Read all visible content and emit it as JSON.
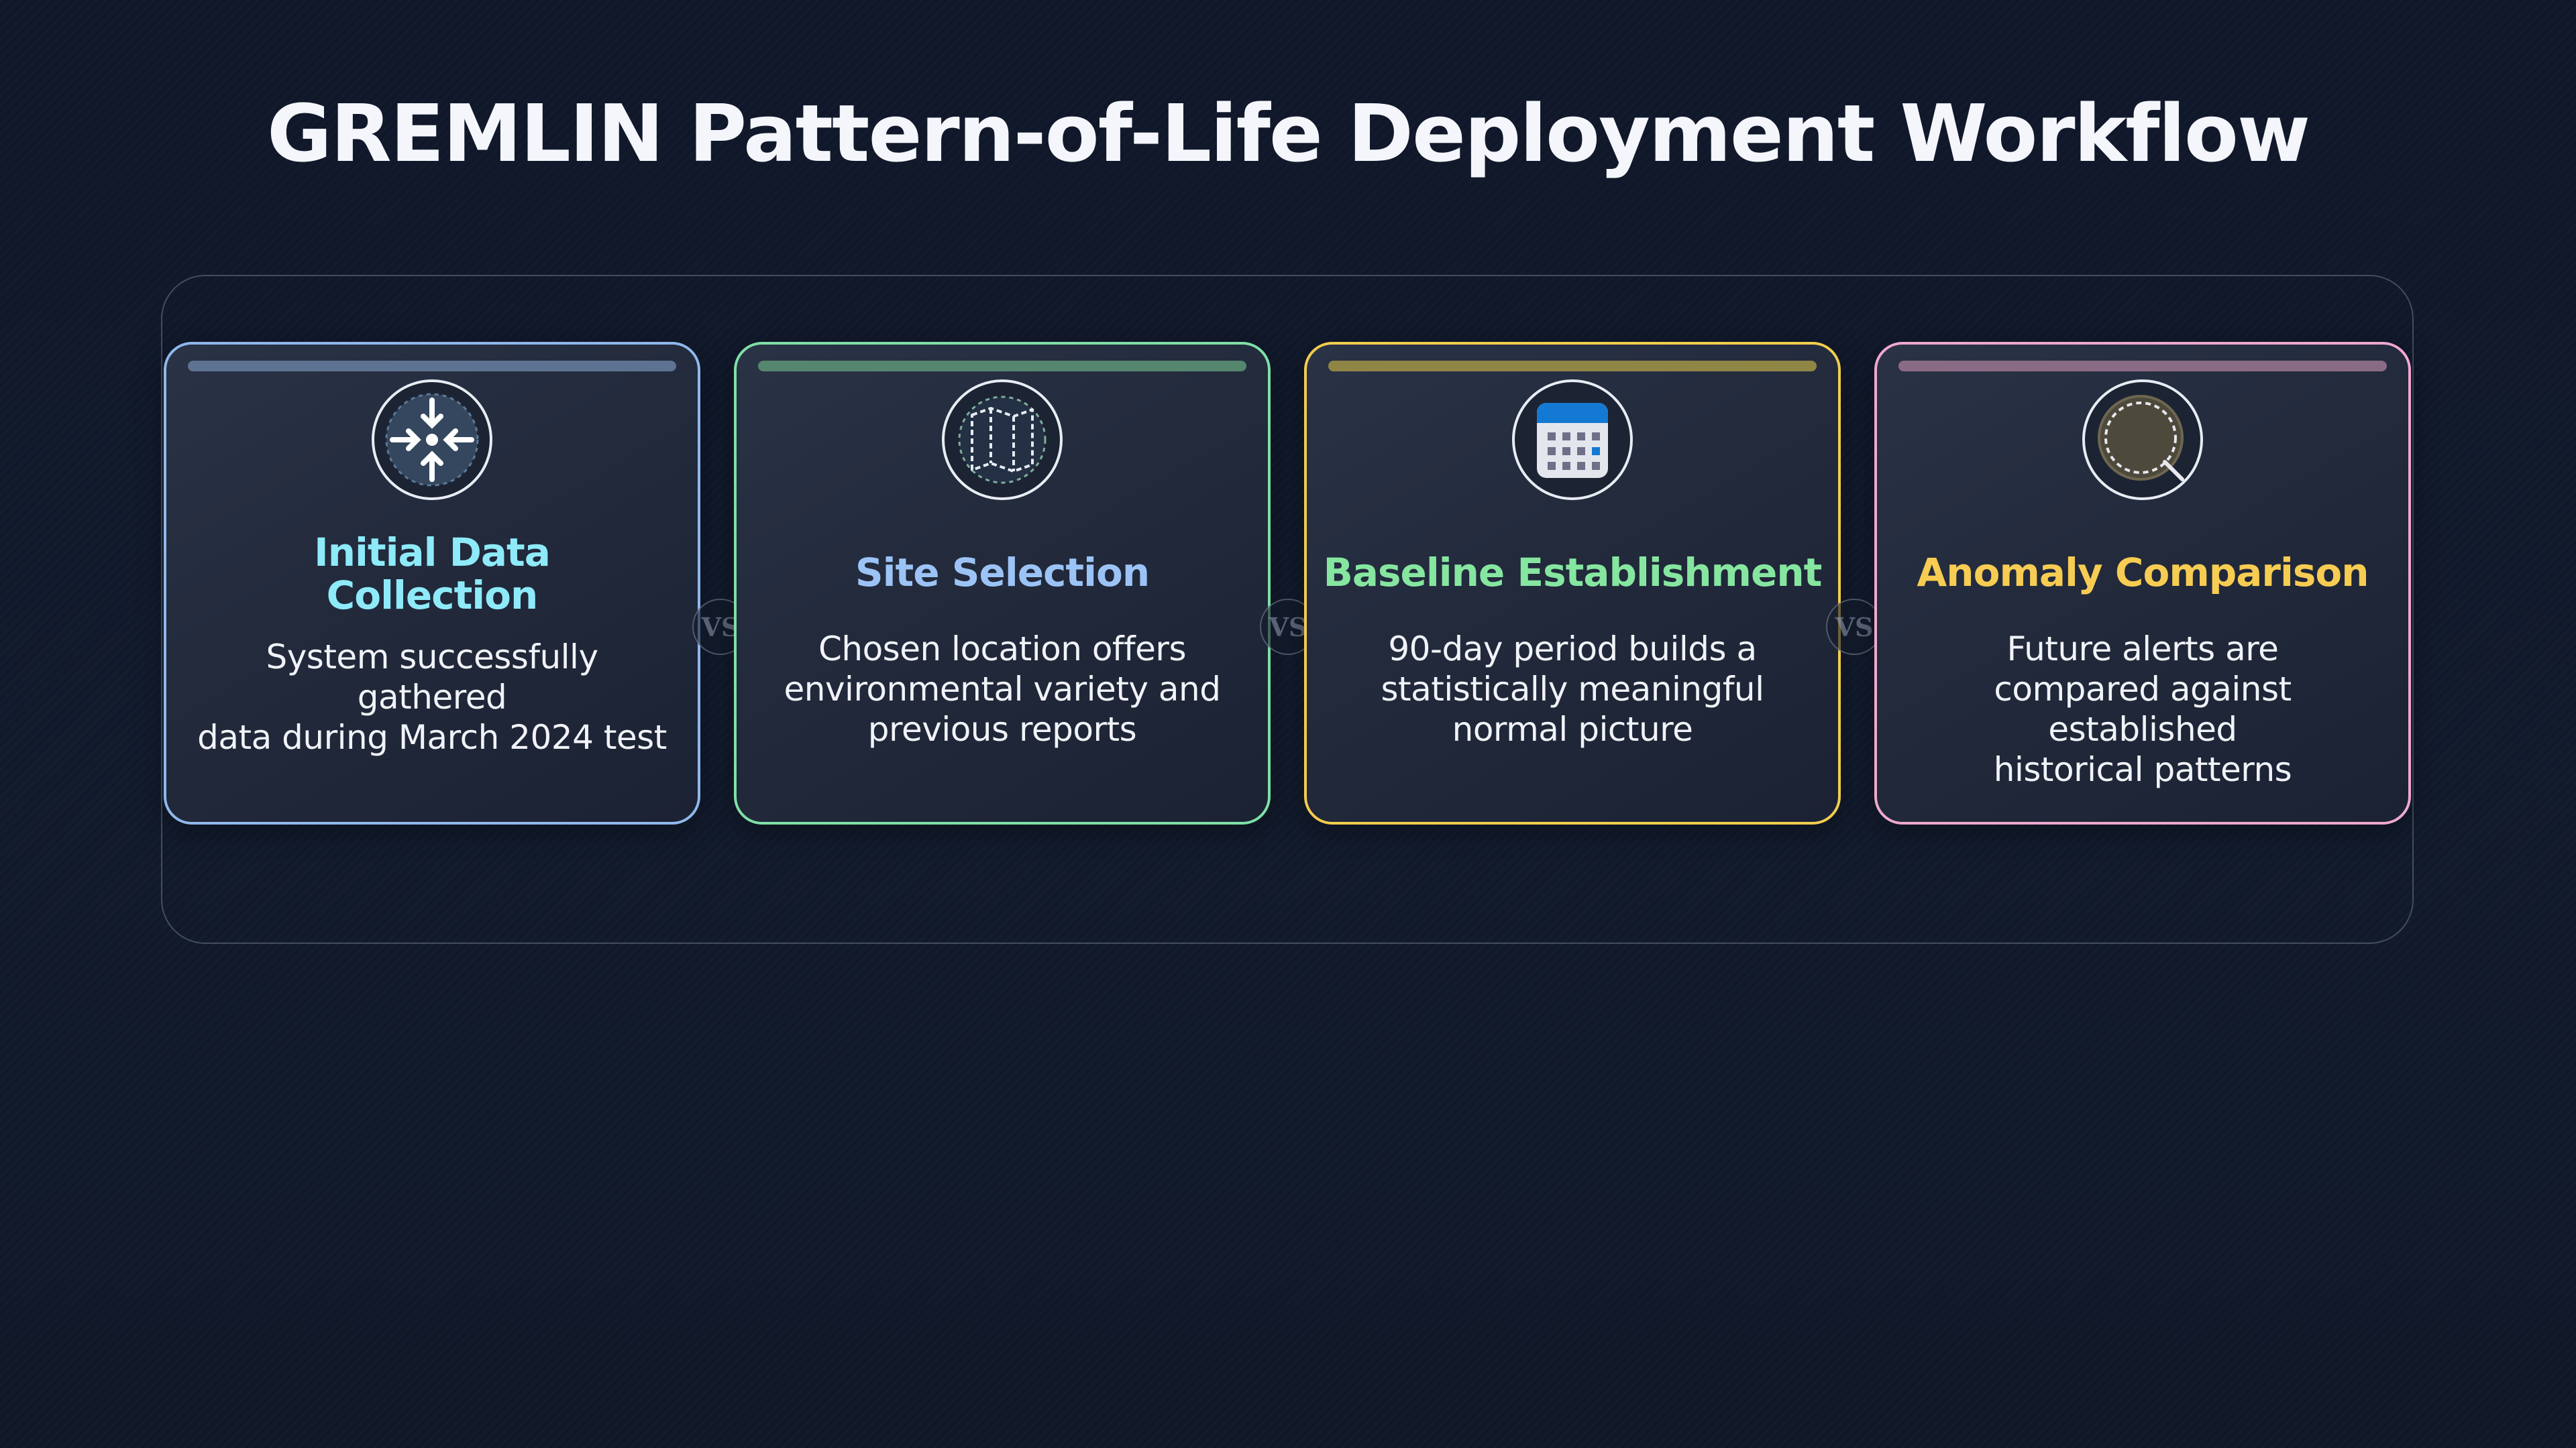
{
  "title": "GREMLIN Pattern-of-Life Deployment Workflow",
  "connector_label": "VS",
  "steps": [
    {
      "title_line1": "Initial Data",
      "title_line2": "Collection",
      "desc_line1": "System successfully gathered",
      "desc_line2": "data during March 2024 test",
      "icon": "collapse-arrows-icon",
      "border_color": "#8fb8ec",
      "bar_color": "#5d7391",
      "title_color": "#8eeaf8"
    },
    {
      "title": "Site Selection",
      "desc_line1": "Chosen location offers",
      "desc_line2": "environmental variety and",
      "desc_line3": "previous reports",
      "icon": "map-icon",
      "border_color": "#7fe0a6",
      "bar_color": "#55866e",
      "title_color": "#9cc3f5"
    },
    {
      "title": "Baseline Establishment",
      "desc_line1": "90-day period builds a",
      "desc_line2": "statistically meaningful",
      "desc_line3": "normal picture",
      "icon": "calendar-icon",
      "border_color": "#f2cd4e",
      "bar_color": "#8f8645",
      "title_color": "#86e6a0"
    },
    {
      "title": "Anomaly Comparison",
      "desc_line1": "Future alerts are",
      "desc_line2": "compared against established",
      "desc_line3": "historical patterns",
      "icon": "magnifier-icon",
      "border_color": "#f0a8cf",
      "bar_color": "#8a6b84",
      "title_color": "#f7cc52"
    }
  ]
}
